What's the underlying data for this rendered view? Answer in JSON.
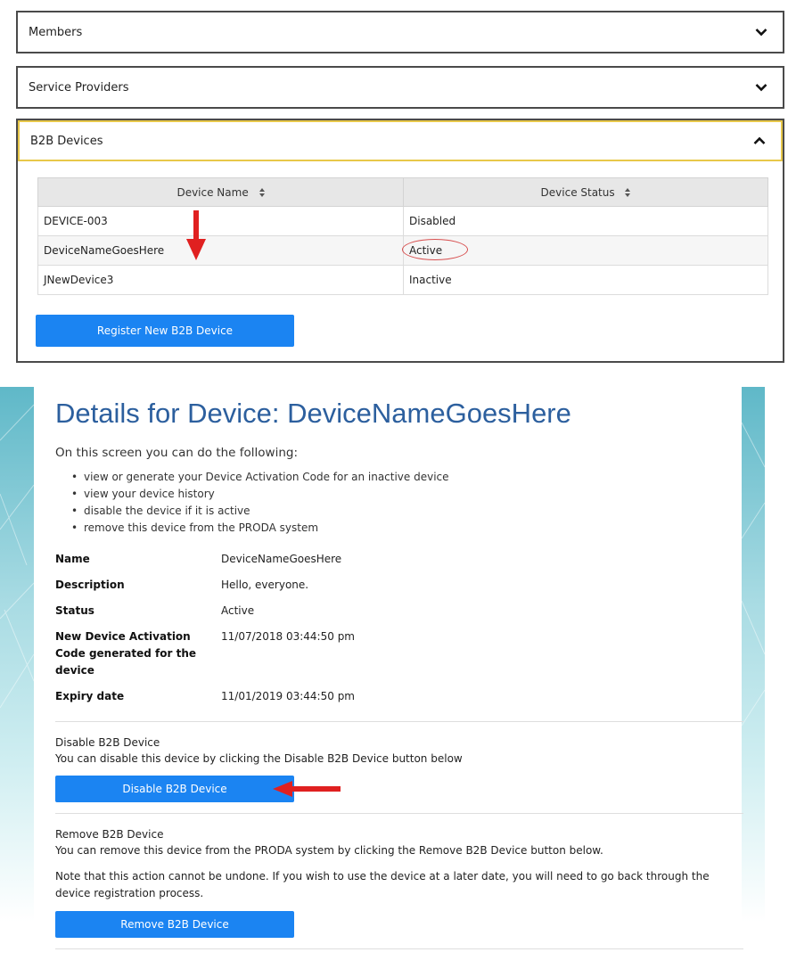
{
  "accordion": {
    "members_label": "Members",
    "service_providers_label": "Service Providers",
    "b2b_devices_label": "B2B Devices",
    "table": {
      "headers": [
        "Device Name",
        "Device Status"
      ],
      "rows": [
        [
          "DEVICE-003",
          "Disabled"
        ],
        [
          "DeviceNameGoesHere",
          "Active"
        ],
        [
          "JNewDevice3",
          "Inactive"
        ]
      ]
    },
    "register_button": "Register New B2B Device"
  },
  "details": {
    "title": "Details for Device: DeviceNameGoesHere",
    "intro": "On this screen you can do the following:",
    "bullets": [
      "view or generate your Device Activation Code for an inactive device",
      "view your device history",
      "disable the device if it is active",
      "remove this device from the PRODA system"
    ],
    "properties": [
      {
        "label": "Name",
        "value": "DeviceNameGoesHere"
      },
      {
        "label": "Description",
        "value": "Hello, everyone."
      },
      {
        "label": "Status",
        "value": "Active"
      },
      {
        "label": "New Device Activation Code generated for the device",
        "value": "11/07/2018 03:44:50 pm"
      },
      {
        "label": "Expiry date",
        "value": "11/01/2019 03:44:50 pm"
      }
    ],
    "disable": {
      "title": "Disable B2B Device",
      "text": "You can disable this device by clicking the Disable B2B Device button below",
      "button": "Disable B2B Device"
    },
    "remove": {
      "title": "Remove B2B Device",
      "text": "You can remove this device from the PRODA system by clicking the Remove B2B Device button below.",
      "note": "Note that this action cannot be undone. If you wish to use the device at a later date, you will need to go back through the device registration process.",
      "button": "Remove B2B Device"
    }
  },
  "colors": {
    "primary_button": "#1b84f2",
    "title_blue": "#2c5f9e",
    "annotation_red": "#e02020",
    "active_header_border": "#e8c84a"
  }
}
